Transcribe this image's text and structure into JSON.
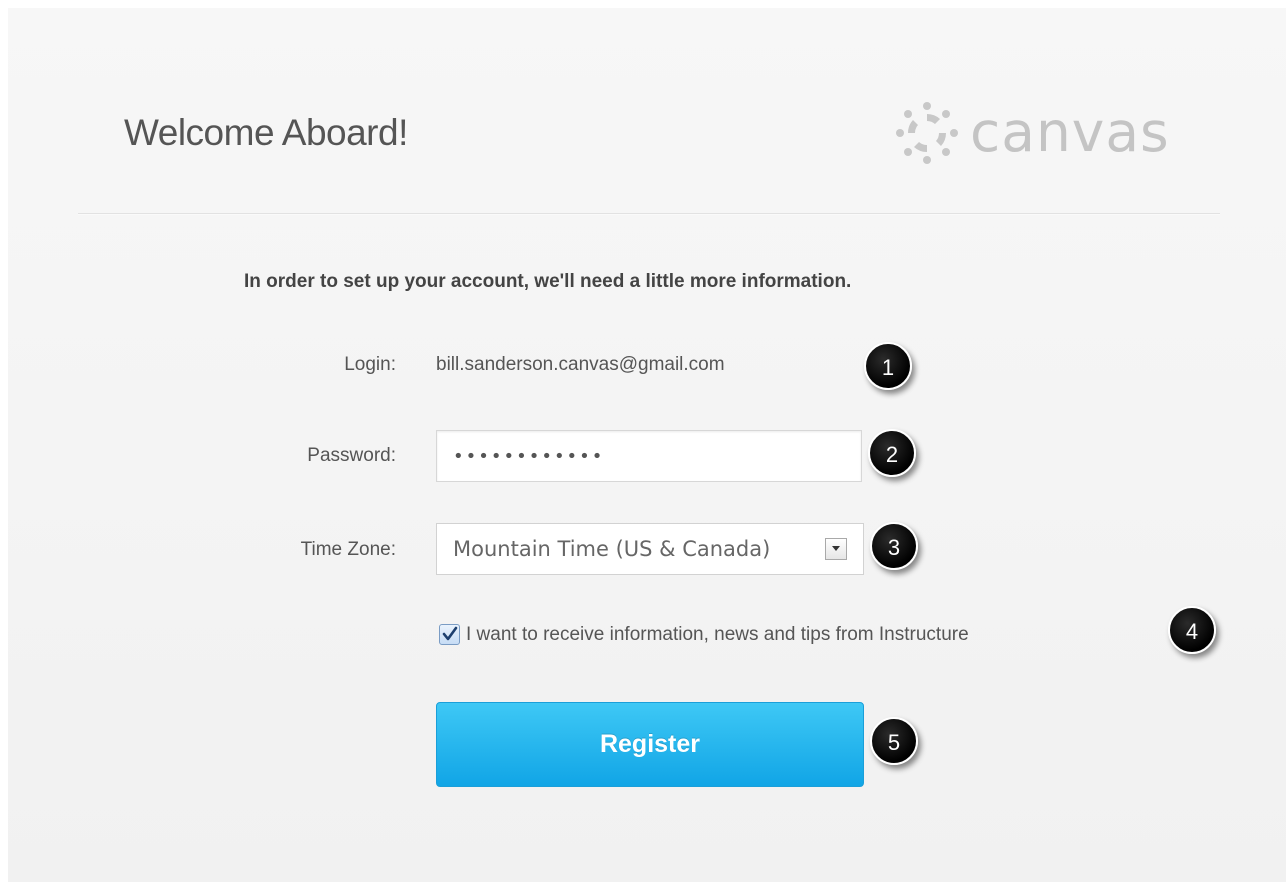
{
  "header": {
    "title": "Welcome Aboard!",
    "logo_text": "canvas"
  },
  "form": {
    "intro": "In order to set up your account, we'll need a little more information.",
    "login_label": "Login:",
    "login_value": "bill.sanderson.canvas@gmail.com",
    "password_label": "Password:",
    "password_value": "••••••••••••",
    "timezone_label": "Time Zone:",
    "timezone_value": "Mountain Time (US & Canada)",
    "newsletter_checked": true,
    "newsletter_label": "I want to receive information, news and tips from Instructure",
    "register_label": "Register"
  },
  "markers": [
    "1",
    "2",
    "3",
    "4",
    "5"
  ],
  "colors": {
    "accent": "#1aaeea",
    "marker": "#000000",
    "logo": "#c4c4c4"
  }
}
